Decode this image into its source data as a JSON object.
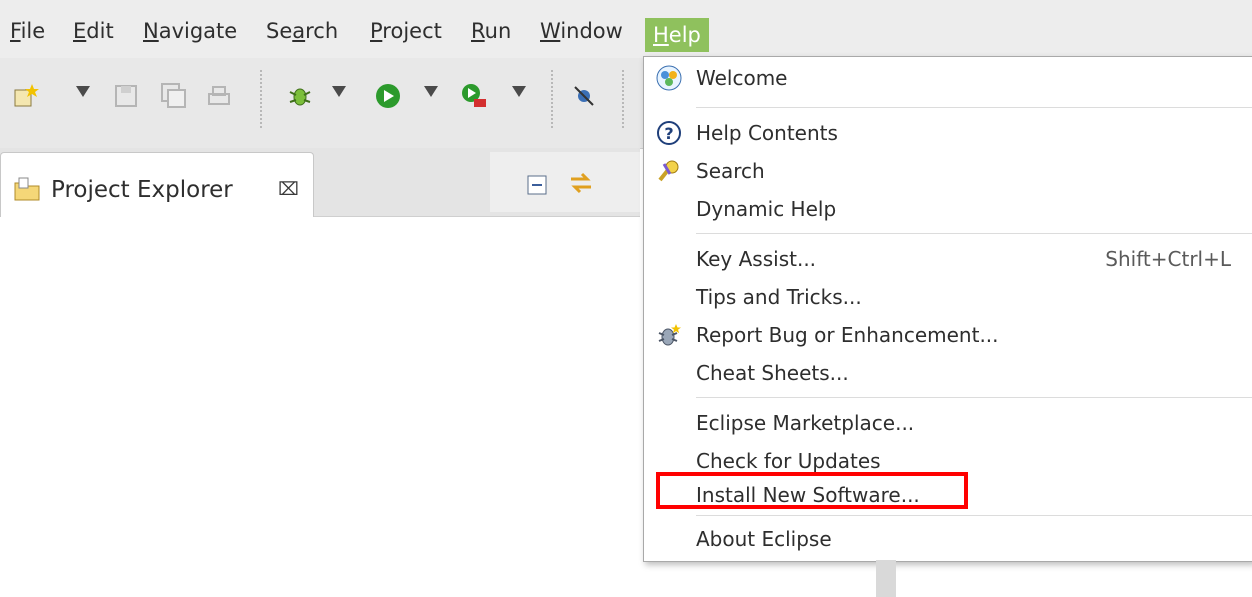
{
  "menubar": {
    "items": [
      {
        "label": "File",
        "mnemonic": "F",
        "rest": "ile"
      },
      {
        "label": "Edit",
        "mnemonic": "E",
        "rest": "dit"
      },
      {
        "label": "Navigate",
        "mnemonic": "N",
        "rest": "avigate"
      },
      {
        "label": "Search",
        "pre": "Se",
        "mnemonic": "a",
        "rest": "rch"
      },
      {
        "label": "Project",
        "mnemonic": "P",
        "rest": "roject"
      },
      {
        "label": "Run",
        "mnemonic": "R",
        "rest": "un"
      },
      {
        "label": "Window",
        "mnemonic": "W",
        "rest": "indow"
      },
      {
        "label": "Help",
        "mnemonic": "H",
        "rest": "elp"
      }
    ]
  },
  "project_explorer": {
    "title": "Project Explorer",
    "close_glyph": "⌧"
  },
  "help_menu": {
    "welcome": "Welcome",
    "help_contents": "Help Contents",
    "search": "Search",
    "dynamic_help": "Dynamic Help",
    "key_assist": "Key Assist...",
    "key_assist_shortcut": "Shift+Ctrl+L",
    "tips_and_tricks": "Tips and Tricks...",
    "report_bug": "Report Bug or Enhancement...",
    "cheat_sheets": "Cheat Sheets...",
    "marketplace": "Eclipse Marketplace...",
    "check_updates": "Check for Updates",
    "install_software": "Install New Software...",
    "about": "About Eclipse"
  },
  "colors": {
    "active_menu": "#8fc15d",
    "highlight_box": "#ff0000"
  }
}
